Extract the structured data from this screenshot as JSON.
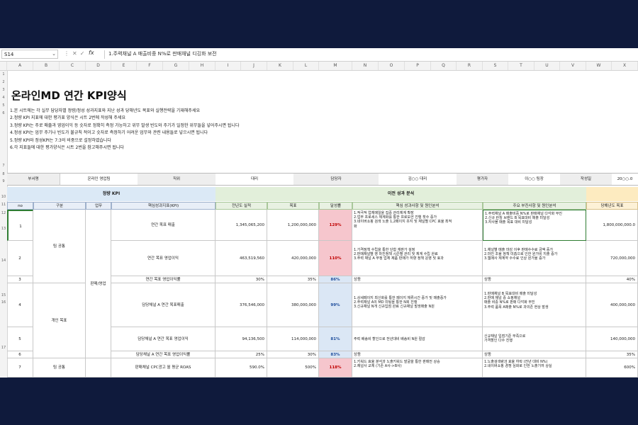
{
  "formula_bar": {
    "cell_ref": "S14",
    "fx_label": "fx",
    "content": "1.주력채널 A 매출비중 N%로 판매채널 디깅화 보전"
  },
  "columns": [
    "A",
    "B",
    "C",
    "D",
    "E",
    "F",
    "G",
    "H",
    "I",
    "J",
    "K",
    "L",
    "M",
    "N",
    "O",
    "P",
    "Q",
    "R",
    "S",
    "T",
    "U",
    "V",
    "W",
    "X"
  ],
  "row_numbers": [
    "1",
    "2",
    "3",
    "4",
    "5",
    "6",
    "7",
    "8",
    "9",
    "10",
    "11",
    "12",
    "13",
    "14",
    "15",
    "16",
    "17",
    "18",
    "19",
    "20"
  ],
  "title": "온라인MD 연간 KPI양식",
  "notes": [
    "1.본 시트에는 각 실무 담당자별 정량/정성 성과지표와 지난 성과 당해년도 목표와 실행전략을 기재해주세요",
    "2.정량 KPI 지표에 대한 평가표 양식은 시트 2번에 작성해 주세요",
    "3.정량 KPI는 주로 매출과 영업이익 등 숫자로 정확히 측정 가능하고 위무 발생 빈도와 주기가 일정한 위무들을 넣어주시면 됩니다",
    "4.정성 KPI는 업무 주기나 빈도가 불규칙 적이고 숫자로 측정하기 어려운 업무와 관련 내용들로 넣으시면 됩니다",
    "5.정량 KPI와 정성KPI는 7:3의 비중으로 설정하였습니다",
    "6.각 지표들에 대한 평가양식은 시트 2번을 참고해주시면 됩니다"
  ],
  "info": {
    "dept_label": "부서명",
    "dept_value": "온라인 영업팀",
    "rank_label": "직위",
    "rank_value": "대리",
    "owner_label": "담당자",
    "owner_value": "김○○ 대리",
    "evaluator_label": "평가자",
    "evaluator_value": "이○○ 팀장",
    "date_label": "작성일",
    "date_value": "20○○.0"
  },
  "sections": {
    "quant": "정량 KPI",
    "prev": "이전 성과 분석"
  },
  "headers": {
    "no": "no",
    "category": "구분",
    "work": "업무",
    "kpi": "핵심성과지표(KPI)",
    "actual": "전년도 실적",
    "target": "목표",
    "rate": "달성률",
    "success": "핵심 성과사항 및 원인분석",
    "weakness": "주요 부진사항 및 원인분석",
    "next_target": "당해년도 목표"
  },
  "groups": {
    "team_common": "팀 공통",
    "personal": "개인 목표",
    "sales_plan": "판매/영업"
  },
  "rows": [
    {
      "no": "1",
      "kpi": "연간 목표 매출",
      "actual": "1,345,065,200",
      "target": "1,200,000,000",
      "rate": "129%",
      "rate_style": "red",
      "success": "1.적극적 업체메일을 집중 관리체계 확장\n2.업무 프로세스 체계화를 통한 프로모션 진행 횟수 증가\n3.네이버쇼핑 검색 노출 1,2페이지 유지 및 채널별 CPC 효율 최적\n화",
      "weakness": "1.주력채널 A 매출비중 N%로 판매채널 다각화 부진\n2.신규 런칭 브랜드 B 목표대비 매출 미달성\n3.자사몰 매출 목표 대비 미달성",
      "next_target": "1,800,000,000.0"
    },
    {
      "no": "2",
      "kpi": "연간 목표 영업이익",
      "actual": "463,519,560",
      "target": "420,000,000",
      "rate": "110%",
      "rate_style": "red",
      "success": "1.가격정책 수립을 통한 단합 재판가 설정\n2.판매채널별 영 마진정책 시즌별 관리 및 체계 수립 완료\n3.주력 채널 A 부정 업체 제품 판매가 하향 정책 운영 및 효과",
      "weakness": "1.채널별 매출 마감 이후 판매수수료 금액 증가\n2.마진 조율 정책 미흡으로 인한 원가비 지출 증가\n3.웹매사 재계약 수수료 인상 원가율 증가",
      "next_target": "720,000,000"
    },
    {
      "no": "3",
      "kpi": "연간 목표 영업이익률",
      "actual": "30%",
      "target": "35%",
      "rate": "86%",
      "rate_style": "blue",
      "success": "상동",
      "weakness": "상동",
      "next_target": "40%"
    },
    {
      "no": "4",
      "kpi": "담당채널 A 연간 목표매출",
      "actual": "376,546,000",
      "target": "380,000,000",
      "rate": "99%",
      "rate_style": "blue",
      "success": "1.상세페이지 최신화를 통한 페이지 체류시간 증가 및 매출증가\n2.주력채널 A의 MD 미팅을 통한 N회 진행\n3.신규채널 N개 신규입점 완료 신규채널 발생매출 N원",
      "weakness": "1.판매채널 B 목표대비 매출 미달성\n2.판매 채널 중 쇼핑채널\n매출 비중 N%로 판매 다각화 부진\n3.주력 품목 A매출 N%로 과의존 현상 발생",
      "next_target": "400,000,000"
    },
    {
      "no": "5",
      "kpi": "담당채널 A 연간 목표 영업이익",
      "actual": "94,136,500",
      "target": "114,000,000",
      "rate": "81%",
      "rate_style": "blue",
      "success": "주력 배송비 할인으로 전년대비 배송비 N원 절감",
      "weakness": "신규채널 입점기준 부족으로\n가격할인 다수 진행",
      "next_target": "140,000,000"
    },
    {
      "no": "6",
      "kpi": "담당채널 A 연간 목표 영업이익률",
      "actual": "25%",
      "target": "30%",
      "rate": "83%",
      "rate_style": "blue",
      "success": "상동",
      "weakness": "상동",
      "next_target": "35%"
    },
    {
      "no": "7",
      "kpi": "판매채널 CPC광고 월 평균 ROAS",
      "actual": "590.0%",
      "target": "500%",
      "rate": "118%",
      "rate_style": "red",
      "success": "1.키워드 효율 분석과 노출키워드 발굴을 통한 판매전 상승\n2.채널사 교체 (기존 A사->B사)",
      "weakness": "1.노출검색량과 효율 하락 (전년 대비 N%)\n2.네이버쇼핑 경쟁 심화로 인한 노출기여 상실",
      "next_target": "600%"
    }
  ]
}
